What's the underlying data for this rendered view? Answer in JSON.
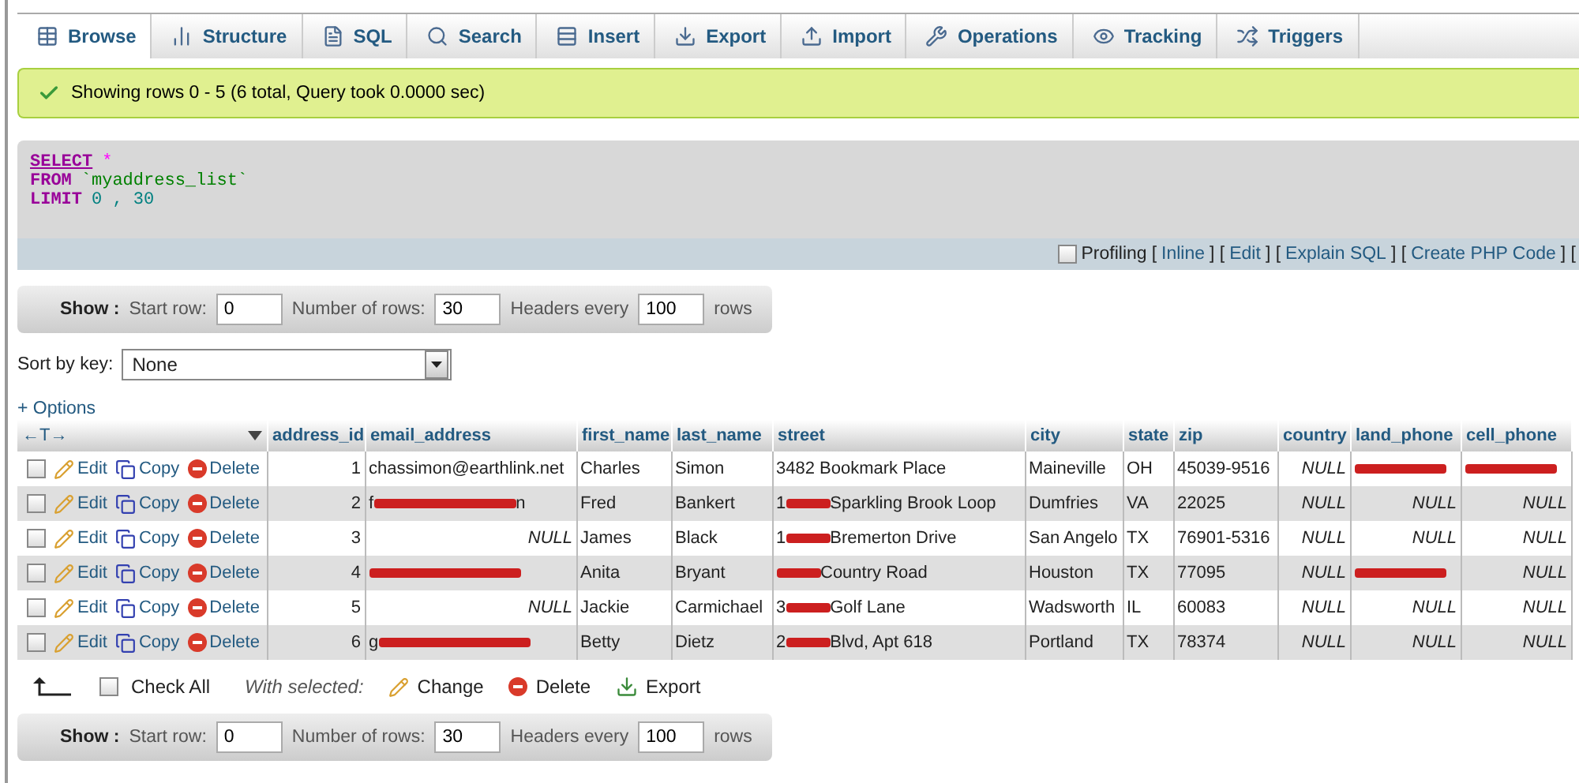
{
  "tabs": [
    {
      "label": "Browse",
      "kind": "browse",
      "selected": true
    },
    {
      "label": "Structure",
      "kind": "structure",
      "selected": false
    },
    {
      "label": "SQL",
      "kind": "sql",
      "selected": false
    },
    {
      "label": "Search",
      "kind": "search",
      "selected": false
    },
    {
      "label": "Insert",
      "kind": "insert",
      "selected": false
    },
    {
      "label": "Export",
      "kind": "export",
      "selected": false
    },
    {
      "label": "Import",
      "kind": "import",
      "selected": false
    },
    {
      "label": "Operations",
      "kind": "operations",
      "selected": false
    },
    {
      "label": "Tracking",
      "kind": "tracking",
      "selected": false
    },
    {
      "label": "Triggers",
      "kind": "triggers",
      "selected": false
    }
  ],
  "message": "Showing rows 0 - 5 (6 total, Query took 0.0000 sec)",
  "sql": [
    [
      {
        "kind": "keyword",
        "text": "SELECT"
      },
      {
        "kind": "operator",
        "text": "*"
      }
    ],
    [
      {
        "kind": "keyword",
        "text": "FROM"
      },
      {
        "kind": "identifier",
        "text": "`myaddress_list`"
      }
    ],
    [
      {
        "kind": "keyword",
        "text": "LIMIT"
      },
      {
        "kind": "number",
        "text": "0 , 30"
      }
    ]
  ],
  "profiling": {
    "checked": false,
    "label": "Profiling",
    "parts": [
      {
        "kind": "text",
        "text": "["
      },
      {
        "kind": "link",
        "text": "Inline"
      },
      {
        "kind": "text",
        "text": "] ["
      },
      {
        "kind": "link",
        "text": "Edit"
      },
      {
        "kind": "text",
        "text": "] ["
      },
      {
        "kind": "link",
        "text": "Explain SQL"
      },
      {
        "kind": "text",
        "text": "] ["
      },
      {
        "kind": "link",
        "text": "Create PHP Code"
      },
      {
        "kind": "text",
        "text": "] ["
      }
    ]
  },
  "show_top": {
    "label": "Show :",
    "fields": [
      {
        "label": "Start row:",
        "value": "0"
      },
      {
        "label": "Number of rows:",
        "value": "30"
      },
      {
        "label": "Headers every",
        "value": "100"
      }
    ],
    "suffix": "rows"
  },
  "sort": {
    "label": "Sort by key:",
    "value": "None"
  },
  "options_link": "+ Options",
  "table": {
    "arrows": "←T→",
    "columns": [
      "address_id",
      "email_address",
      "first_name",
      "last_name",
      "street",
      "city",
      "state",
      "zip",
      "country",
      "land_phone",
      "cell_phone"
    ],
    "rows": [
      {
        "checked": false,
        "actions": [
          {
            "kind": "edit",
            "label": "Edit"
          },
          {
            "kind": "copy",
            "label": "Copy"
          },
          {
            "kind": "delete",
            "label": "Delete"
          }
        ],
        "cells": [
          {
            "kind": "number",
            "text": "1"
          },
          {
            "kind": "text",
            "text": "chassimon@earthlink.net"
          },
          {
            "kind": "text",
            "text": "Charles"
          },
          {
            "kind": "text",
            "text": "Simon"
          },
          {
            "kind": "text",
            "text": "3482 Bookmark Place"
          },
          {
            "kind": "text",
            "text": "Maineville"
          },
          {
            "kind": "text",
            "text": "OH"
          },
          {
            "kind": "text",
            "text": "45039-9516"
          },
          {
            "kind": "null",
            "text": "NULL"
          },
          {
            "kind": "redacted"
          },
          {
            "kind": "redacted"
          }
        ]
      },
      {
        "checked": false,
        "actions": [
          {
            "kind": "edit",
            "label": "Edit"
          },
          {
            "kind": "copy",
            "label": "Copy"
          },
          {
            "kind": "delete",
            "label": "Delete"
          }
        ],
        "cells": [
          {
            "kind": "number",
            "text": "2"
          },
          {
            "kind": "redacted",
            "lead": "f",
            "text": "n"
          },
          {
            "kind": "text",
            "text": "Fred"
          },
          {
            "kind": "text",
            "text": "Bankert"
          },
          {
            "kind": "redacted",
            "lead": "1",
            "text": "Sparkling Brook Loop"
          },
          {
            "kind": "text",
            "text": "Dumfries"
          },
          {
            "kind": "text",
            "text": "VA"
          },
          {
            "kind": "text",
            "text": "22025"
          },
          {
            "kind": "null",
            "text": "NULL"
          },
          {
            "kind": "null",
            "text": "NULL"
          },
          {
            "kind": "null",
            "text": "NULL"
          }
        ]
      },
      {
        "checked": false,
        "actions": [
          {
            "kind": "edit",
            "label": "Edit"
          },
          {
            "kind": "copy",
            "label": "Copy"
          },
          {
            "kind": "delete",
            "label": "Delete"
          }
        ],
        "cells": [
          {
            "kind": "number",
            "text": "3"
          },
          {
            "kind": "null",
            "text": "NULL"
          },
          {
            "kind": "text",
            "text": "James"
          },
          {
            "kind": "text",
            "text": "Black"
          },
          {
            "kind": "redacted",
            "lead": "1",
            "text": "Bremerton Drive"
          },
          {
            "kind": "text",
            "text": "San Angelo"
          },
          {
            "kind": "text",
            "text": "TX"
          },
          {
            "kind": "text",
            "text": "76901-5316"
          },
          {
            "kind": "null",
            "text": "NULL"
          },
          {
            "kind": "null",
            "text": "NULL"
          },
          {
            "kind": "null",
            "text": "NULL"
          }
        ]
      },
      {
        "checked": false,
        "actions": [
          {
            "kind": "edit",
            "label": "Edit"
          },
          {
            "kind": "copy",
            "label": "Copy"
          },
          {
            "kind": "delete",
            "label": "Delete"
          }
        ],
        "cells": [
          {
            "kind": "number",
            "text": "4"
          },
          {
            "kind": "redacted"
          },
          {
            "kind": "text",
            "text": "Anita"
          },
          {
            "kind": "text",
            "text": "Bryant"
          },
          {
            "kind": "redacted",
            "text": "Country Road"
          },
          {
            "kind": "text",
            "text": "Houston"
          },
          {
            "kind": "text",
            "text": "TX"
          },
          {
            "kind": "text",
            "text": "77095"
          },
          {
            "kind": "null",
            "text": "NULL"
          },
          {
            "kind": "redacted"
          },
          {
            "kind": "null",
            "text": "NULL"
          }
        ]
      },
      {
        "checked": false,
        "actions": [
          {
            "kind": "edit",
            "label": "Edit"
          },
          {
            "kind": "copy",
            "label": "Copy"
          },
          {
            "kind": "delete",
            "label": "Delete"
          }
        ],
        "cells": [
          {
            "kind": "number",
            "text": "5"
          },
          {
            "kind": "null",
            "text": "NULL"
          },
          {
            "kind": "text",
            "text": "Jackie"
          },
          {
            "kind": "text",
            "text": "Carmichael"
          },
          {
            "kind": "redacted",
            "lead": "3",
            "text": "Golf Lane"
          },
          {
            "kind": "text",
            "text": "Wadsworth"
          },
          {
            "kind": "text",
            "text": "IL"
          },
          {
            "kind": "text",
            "text": "60083"
          },
          {
            "kind": "null",
            "text": "NULL"
          },
          {
            "kind": "null",
            "text": "NULL"
          },
          {
            "kind": "null",
            "text": "NULL"
          }
        ]
      },
      {
        "checked": false,
        "actions": [
          {
            "kind": "edit",
            "label": "Edit"
          },
          {
            "kind": "copy",
            "label": "Copy"
          },
          {
            "kind": "delete",
            "label": "Delete"
          }
        ],
        "cells": [
          {
            "kind": "number",
            "text": "6"
          },
          {
            "kind": "redacted",
            "lead": "g"
          },
          {
            "kind": "text",
            "text": "Betty"
          },
          {
            "kind": "text",
            "text": "Dietz"
          },
          {
            "kind": "redacted",
            "lead": "2",
            "text": "Blvd, Apt 618"
          },
          {
            "kind": "text",
            "text": "Portland"
          },
          {
            "kind": "text",
            "text": "TX"
          },
          {
            "kind": "text",
            "text": "78374"
          },
          {
            "kind": "null",
            "text": "NULL"
          },
          {
            "kind": "null",
            "text": "NULL"
          },
          {
            "kind": "null",
            "text": "NULL"
          }
        ]
      }
    ]
  },
  "bulk": {
    "check_all": {
      "checked": false,
      "label": "Check All"
    },
    "with_selected": "With selected:",
    "actions": [
      {
        "kind": "edit",
        "label": "Change"
      },
      {
        "kind": "delete",
        "label": "Delete"
      },
      {
        "kind": "export",
        "label": "Export"
      }
    ]
  },
  "show_bottom": {
    "label": "Show :",
    "fields": [
      {
        "label": "Start row:",
        "value": "0"
      },
      {
        "label": "Number of rows:",
        "value": "30"
      },
      {
        "label": "Headers every",
        "value": "100"
      }
    ],
    "suffix": "rows"
  }
}
